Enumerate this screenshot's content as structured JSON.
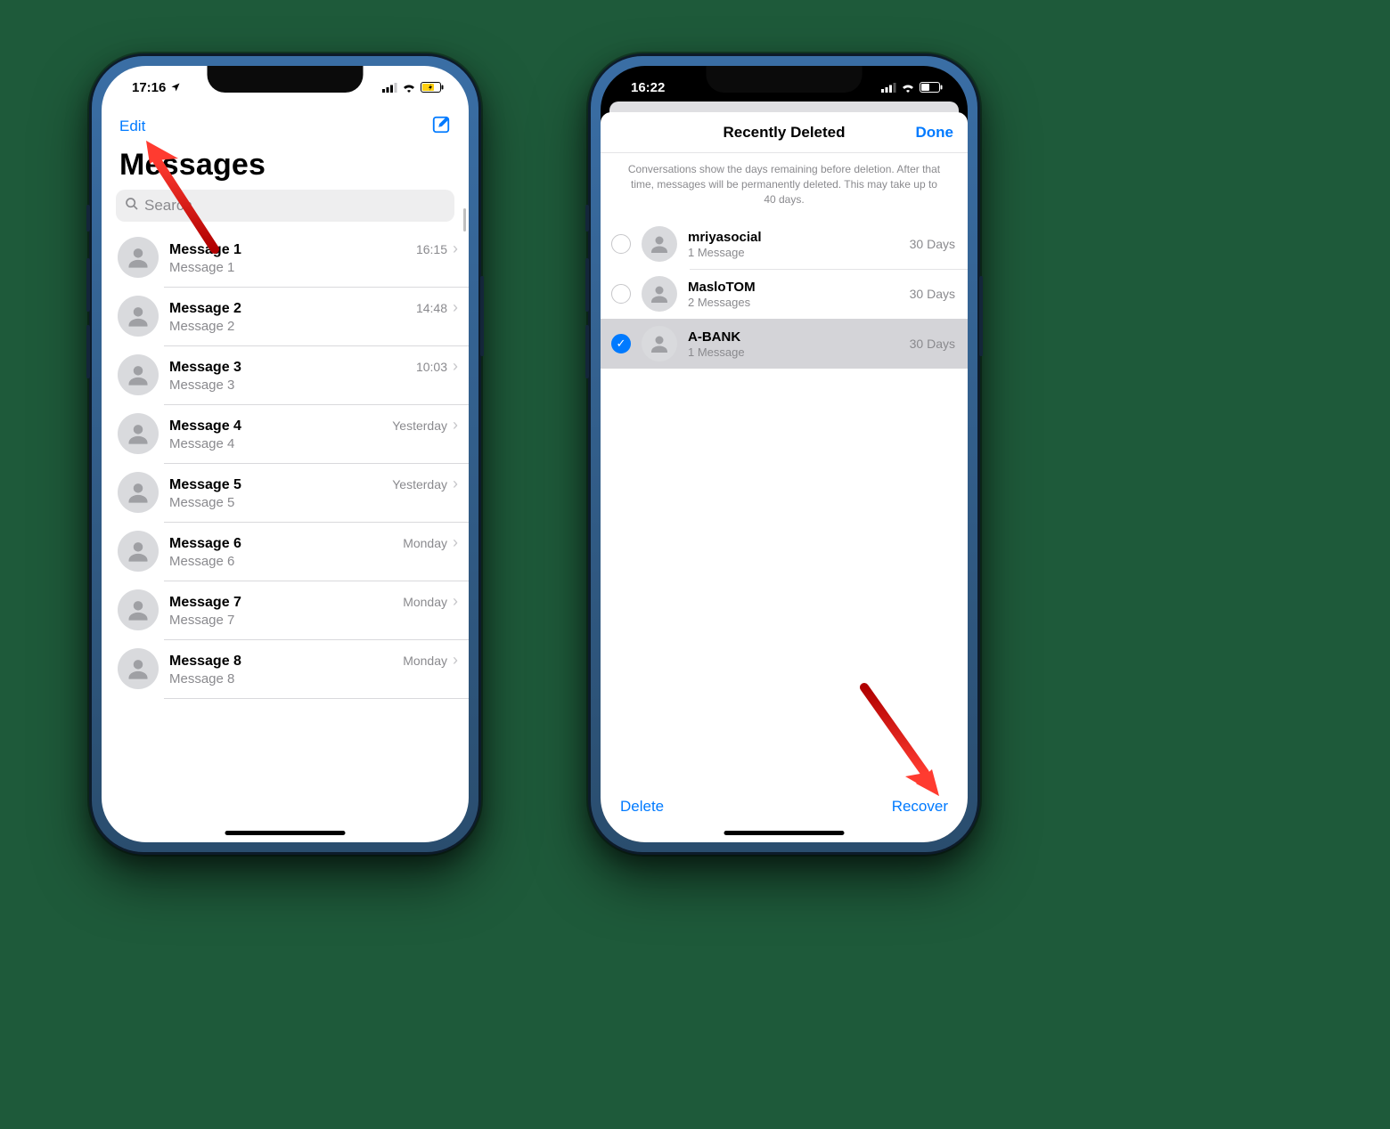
{
  "phone1": {
    "time": "17:16",
    "edit_label": "Edit",
    "title": "Messages",
    "search_placeholder": "Search",
    "messages": [
      {
        "title": "Message 1",
        "subtitle": "Message 1",
        "time": "16:15"
      },
      {
        "title": "Message 2",
        "subtitle": "Message 2",
        "time": "14:48"
      },
      {
        "title": "Message 3",
        "subtitle": "Message 3",
        "time": "10:03"
      },
      {
        "title": "Message 4",
        "subtitle": "Message 4",
        "time": "Yesterday"
      },
      {
        "title": "Message 5",
        "subtitle": "Message 5",
        "time": "Yesterday"
      },
      {
        "title": "Message 6",
        "subtitle": "Message 6",
        "time": "Monday"
      },
      {
        "title": "Message 7",
        "subtitle": "Message 7",
        "time": "Monday"
      },
      {
        "title": "Message 8",
        "subtitle": "Message 8",
        "time": "Monday"
      }
    ]
  },
  "phone2": {
    "time": "16:22",
    "header_title": "Recently Deleted",
    "done_label": "Done",
    "info_text": "Conversations show the days remaining before deletion. After that time, messages will be permanently deleted. This may take up to 40 days.",
    "items": [
      {
        "title": "mriyasocial",
        "subtitle": "1 Message",
        "days": "30 Days",
        "selected": false
      },
      {
        "title": "MasloTOM",
        "subtitle": "2 Messages",
        "days": "30 Days",
        "selected": false
      },
      {
        "title": "A-BANK",
        "subtitle": "1 Message",
        "days": "30 Days",
        "selected": true
      }
    ],
    "delete_label": "Delete",
    "recover_label": "Recover"
  }
}
